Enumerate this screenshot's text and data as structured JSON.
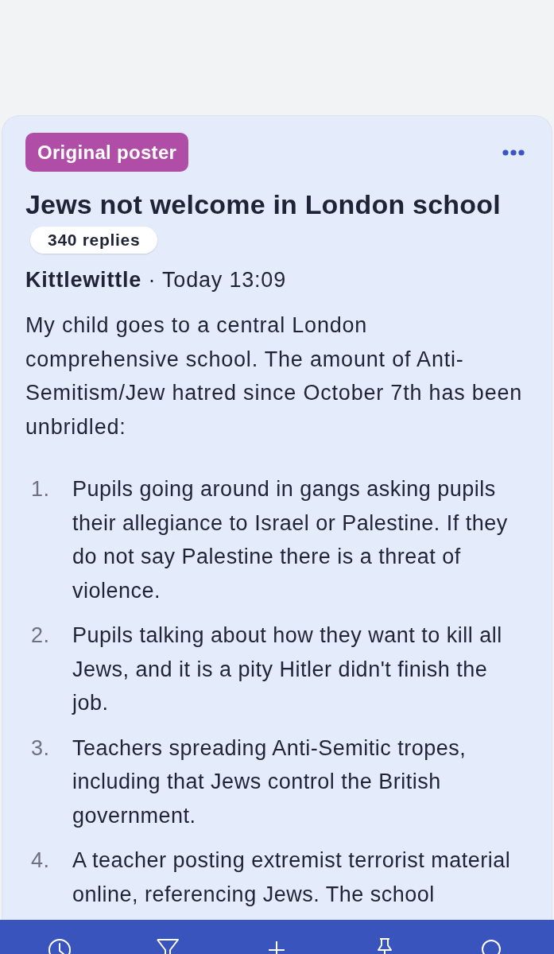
{
  "post": {
    "badge": "Original poster",
    "title": "Jews not welcome in London school",
    "reply_count": "340 replies",
    "author": "Kittlewittle",
    "separator": "·",
    "timestamp": "Today 13:09",
    "body": "My child goes to a central London comprehensive school. The amount of Anti-Semitism/Jew hatred since October 7th has been unbridled:",
    "list_items": [
      {
        "number": "1.",
        "text": "Pupils going around in gangs asking pupils their allegiance to Israel or Palestine. If they do not say Palestine there is a threat of violence."
      },
      {
        "number": "2.",
        "text": "Pupils talking about how they want to kill all Jews, and it is a pity Hitler didn't finish the job."
      },
      {
        "number": "3.",
        "text": "Teachers spreading Anti-Semitic tropes, including that Jews control the British government."
      },
      {
        "number": "4.",
        "text": "A teacher posting extremist terrorist material online, referencing Jews. The school"
      }
    ]
  }
}
